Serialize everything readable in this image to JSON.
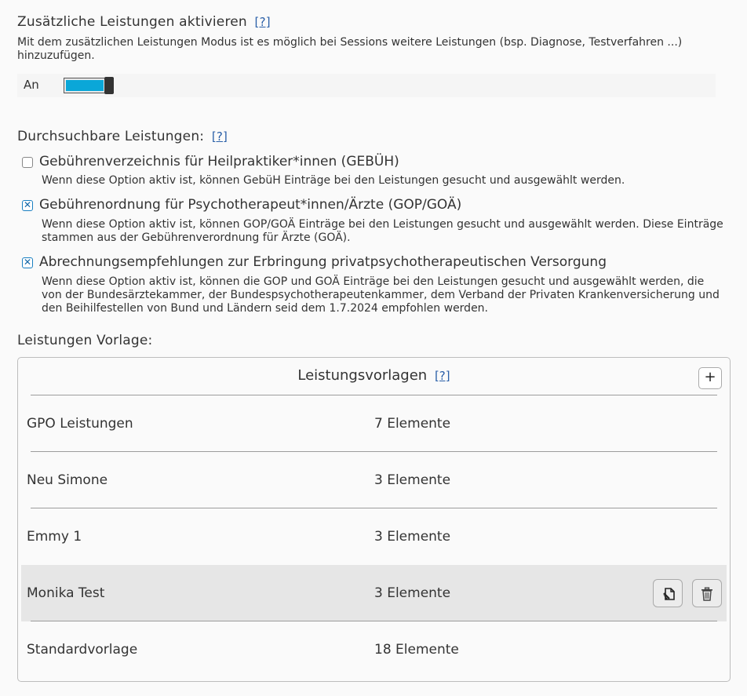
{
  "extra_services": {
    "title": "Zusätzliche Leistungen aktivieren",
    "help": "[?]",
    "description": "Mit dem zusätzlichen Leistungen Modus ist es möglich bei Sessions weitere Leistungen (bsp. Diagnose, Testverfahren ...) hinzuzufügen.",
    "toggle_label": "An",
    "toggle_on": true
  },
  "searchable": {
    "title": "Durchsuchbare Leistungen:",
    "help": "[?]",
    "options": [
      {
        "label": "Gebührenverzeichnis für Heilpraktiker*innen (GEBÜH)",
        "checked": false,
        "description": "Wenn diese Option aktiv ist, können GebüH Einträge bei den Leistungen gesucht und ausgewählt werden."
      },
      {
        "label": "Gebührenordnung für Psychotherapeut*innen/Ärzte (GOP/GOÄ)",
        "checked": true,
        "description": "Wenn diese Option aktiv ist, können GOP/GOÄ Einträge bei den Leistungen gesucht und ausgewählt werden. Diese Einträge stammen aus der Gebührenverordnung für Ärzte (GOÄ)."
      },
      {
        "label": "Abrechnungsempfehlungen zur Erbringung privatpsychotherapeutischen Versorgung",
        "checked": true,
        "description": "Wenn diese Option aktiv ist, können die GOP und GOÄ Einträge bei den Leistungen gesucht und ausgewählt werden, die von der Bundesärztekammer, der Bundespsychotherapeutenkammer, dem Verband der Privaten Krankenversicherung und den Beihilfestellen von Bund und Ländern seid dem 1.7.2024 empfohlen werden."
      }
    ]
  },
  "templates": {
    "section_label": "Leistungen Vorlage:",
    "panel_title": "Leistungsvorlagen",
    "help": "[?]",
    "add_label": "+",
    "rows": [
      {
        "name": "GPO Leistungen",
        "count": "7 Elemente"
      },
      {
        "name": "Neu Simone",
        "count": "3 Elemente"
      },
      {
        "name": "Emmy 1",
        "count": "3 Elemente"
      },
      {
        "name": "Monika Test",
        "count": "3 Elemente"
      },
      {
        "name": "Standardvorlage",
        "count": "18 Elemente"
      }
    ]
  },
  "colors": {
    "accent": "#0aa7d8",
    "link": "#2a5fa8",
    "hover_row": "#e6e6e6"
  },
  "icons": {
    "row_edit": "edit-document-icon",
    "row_delete": "trash-icon"
  }
}
